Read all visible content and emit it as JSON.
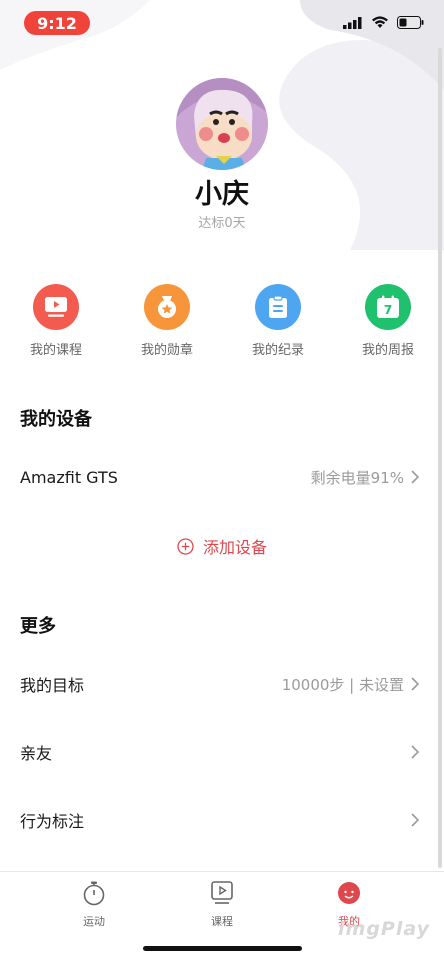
{
  "status_bar": {
    "time": "9:12"
  },
  "profile": {
    "name": "小庆",
    "subtitle": "达标0天"
  },
  "quick_actions": [
    {
      "label": "我的课程",
      "icon": "video-course-icon",
      "color": "#f25b4d"
    },
    {
      "label": "我的勋章",
      "icon": "medal-icon",
      "color": "#f7953a"
    },
    {
      "label": "我的纪录",
      "icon": "clipboard-record-icon",
      "color": "#4ea6f0"
    },
    {
      "label": "我的周报",
      "icon": "calendar-weekly-icon",
      "color": "#1fc16f",
      "badge": "7"
    }
  ],
  "devices": {
    "title": "我的设备",
    "items": [
      {
        "name": "Amazfit GTS",
        "value": "剩余电量91%"
      }
    ],
    "add_label": "添加设备"
  },
  "more": {
    "title": "更多",
    "items": [
      {
        "label": "我的目标",
        "value": "10000步 | 未设置"
      },
      {
        "label": "亲友",
        "value": ""
      },
      {
        "label": "行为标注",
        "value": ""
      }
    ]
  },
  "tabs": [
    {
      "label": "运动",
      "icon": "stopwatch-icon",
      "active": false
    },
    {
      "label": "课程",
      "icon": "play-box-icon",
      "active": false
    },
    {
      "label": "我的",
      "icon": "profile-icon",
      "active": true
    }
  ],
  "watermark": "imgPlay",
  "colors": {
    "accent": "#e0474c",
    "status_pill": "#f0443a"
  }
}
